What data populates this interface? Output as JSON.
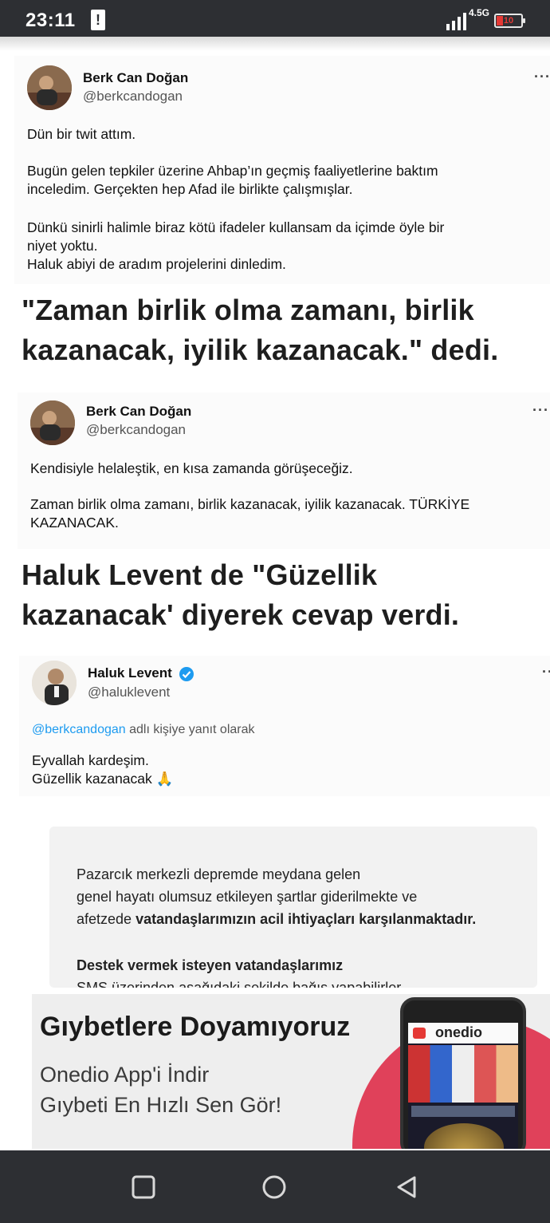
{
  "status_bar": {
    "time": "23:11",
    "alert_glyph": "!",
    "network": "4.5G",
    "battery": "10"
  },
  "tweets": [
    {
      "name": "Berk Can Doğan",
      "handle": "@berkcandogan",
      "more": "···",
      "paragraphs": [
        "Dün bir twit attım.",
        "Bugün gelen tepkiler üzerine Ahbap’ın geçmiş faaliyetlerine baktım\ninceledim. Gerçekten hep Afad ile birlikte çalışmışlar.",
        "Dünkü sinirli halimle biraz kötü ifadeler kullansam da içimde öyle bir\nniyet yoktu.\nHaluk abiyi de aradım projelerini dinledim."
      ]
    },
    {
      "name": "Berk Can Doğan",
      "handle": "@berkcandogan",
      "more": "···",
      "paragraphs": [
        "Kendisiyle helaleştik, en kısa zamanda görüşeceğiz.",
        "Zaman birlik olma zamanı, birlik kazanacak, iyilik kazanacak. TÜRKİYE\nKAZANACAK."
      ]
    },
    {
      "name": "Haluk Levent",
      "handle": "@haluklevent",
      "more": "··",
      "reply_mention": "@berkcandogan",
      "reply_text": " adlı kişiye yanıt olarak",
      "paragraphs": [
        "Eyvallah kardeşim.\nGüzellik kazanacak 🙏"
      ]
    }
  ],
  "headlines": [
    "\"Zaman birlik olma zamanı, birlik\nkazanacak, iyilik kazanacak.\" dedi.",
    "Haluk Levent de \"Güzellik\nkazanacak' diyerek cevap verdi."
  ],
  "infobox": {
    "p1_a": "Pazarcık merkezli depremde meydana gelen\ngenel hayatı olumsuz etkileyen şartlar giderilmekte ve\nafetzede ",
    "p1_b": "vatandaşlarımızın acil ihtiyaçları karşılanmaktadır.",
    "p2": "Destek vermek isteyen vatandaşlarımız",
    "p3": "SMS üzerinden aşağıdaki şekilde bağış yapabilirler."
  },
  "ad": {
    "title": "Gıybetlere Doyamıyoruz",
    "line1": "Onedio App'i İndir",
    "line2": "Gıybeti En Hızlı Sen Gör!",
    "phone_brand": "onedio",
    "accent": "#e0415a"
  },
  "navbar": {
    "icons": [
      "recents-square-icon",
      "home-circle-icon",
      "back-triangle-icon"
    ]
  }
}
